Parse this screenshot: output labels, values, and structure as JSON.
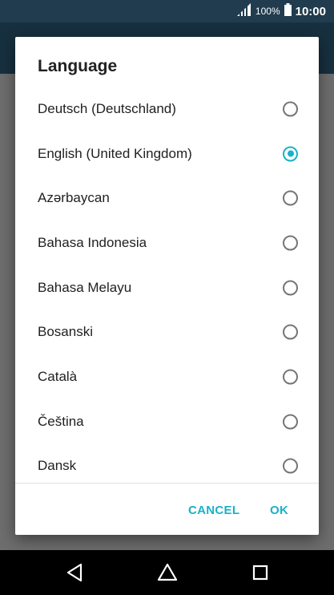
{
  "status_bar": {
    "battery_percent": "100%",
    "time": "10:00",
    "icons": [
      "signal-icon",
      "battery-icon"
    ]
  },
  "dialog": {
    "title": "Language",
    "options": [
      {
        "label": "Deutsch (Deutschland)",
        "selected": false
      },
      {
        "label": "English (United Kingdom)",
        "selected": true
      },
      {
        "label": "Azərbaycan",
        "selected": false
      },
      {
        "label": "Bahasa Indonesia",
        "selected": false
      },
      {
        "label": "Bahasa Melayu",
        "selected": false
      },
      {
        "label": "Bosanski",
        "selected": false
      },
      {
        "label": "Català",
        "selected": false
      },
      {
        "label": "Čeština",
        "selected": false
      },
      {
        "label": "Dansk",
        "selected": false
      }
    ],
    "cancel_label": "CANCEL",
    "ok_label": "OK"
  },
  "nav_bar": {
    "icons": [
      "back-icon",
      "home-icon",
      "recents-icon"
    ]
  },
  "colors": {
    "accent": "#19b2c7",
    "status_bar": "#203c4e",
    "scrim": "#4a4a4a"
  }
}
